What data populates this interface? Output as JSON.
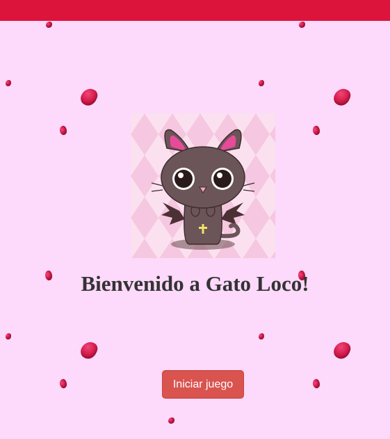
{
  "header": {
    "bar_color": "#dc133b"
  },
  "main": {
    "mascot_icon": "vampire-cat-icon",
    "title": "Bienvenido a Gato Loco!",
    "start_button_label": "Iniciar juego"
  },
  "decor": {
    "petal_icon": "rose-petal-icon"
  },
  "colors": {
    "background": "#fdd9fb",
    "button": "#d9534f",
    "title_text": "#333333"
  }
}
